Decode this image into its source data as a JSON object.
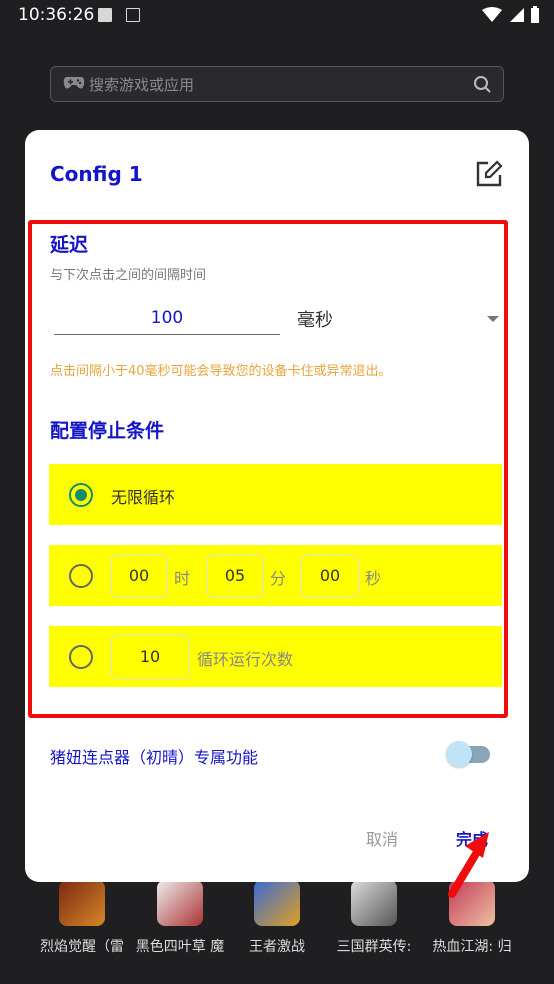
{
  "status": {
    "time": "10:36:26"
  },
  "search": {
    "placeholder": "搜索游戏或应用"
  },
  "dialog": {
    "title": "Config 1",
    "delay": {
      "title": "延迟",
      "subtitle": "与下次点击之间的间隔时间",
      "value": "100",
      "unit": "毫秒",
      "warning": "点击间隔小于40毫秒可能会导致您的设备卡住或异常退出。"
    },
    "stop": {
      "title": "配置停止条件",
      "infinite_label": "无限循环",
      "timer": {
        "hours": "00",
        "hours_unit": "时",
        "minutes": "05",
        "minutes_unit": "分",
        "seconds": "00",
        "seconds_unit": "秒"
      },
      "count": {
        "value": "10",
        "label": "循环运行次数"
      },
      "selected": "infinite"
    },
    "exclusive_label": "猪妞连点器（初晴）专属功能",
    "exclusive_enabled": false,
    "cancel_label": "取消",
    "done_label": "完成"
  },
  "background_apps": [
    {
      "name": "烈焰觉醒（雷"
    },
    {
      "name": "黑色四叶草 魔"
    },
    {
      "name": "王者激战"
    },
    {
      "name": "三国群英传:"
    },
    {
      "name": "热血江湖: 归"
    }
  ],
  "colors": {
    "accent": "#1515c8",
    "highlight": "#ffff00",
    "annotation_red": "#ef0c0c",
    "radio_green": "#128c6b",
    "warning": "#e9a43a"
  }
}
